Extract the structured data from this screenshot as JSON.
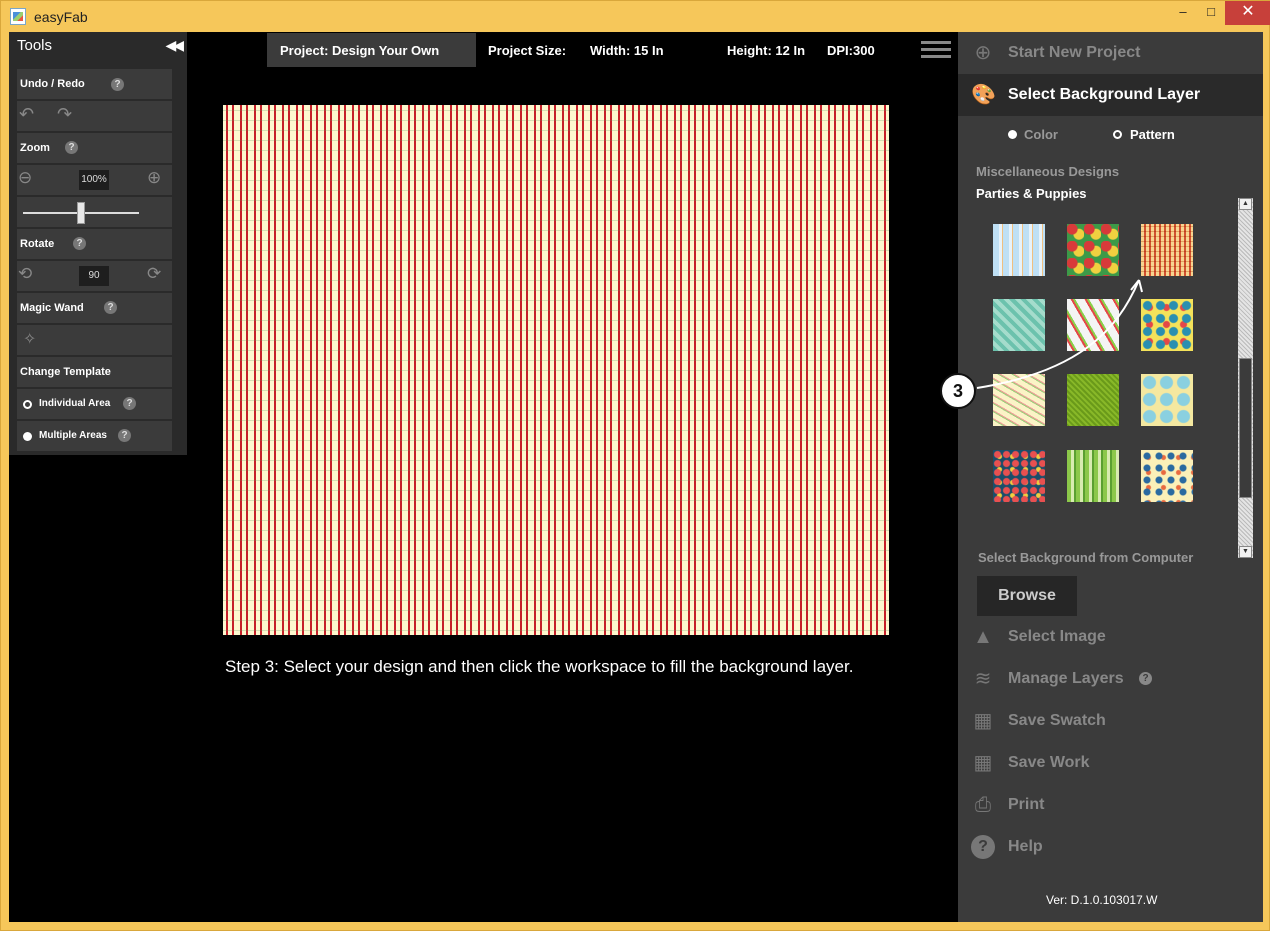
{
  "window": {
    "title": "easyFab",
    "minimize": "–",
    "maximize": "□",
    "close": "✕"
  },
  "tools": {
    "title": "Tools",
    "collapse": "◀◀",
    "undo_redo": "Undo / Redo",
    "zoom": "Zoom",
    "zoom_value": "100%",
    "zoom_slider_level": 0.5,
    "rotate": "Rotate",
    "rotate_value": "90",
    "magic_wand": "Magic Wand",
    "change_template": "Change Template",
    "individual_area": "Individual Area",
    "multiple_areas": "Multiple Areas",
    "help": "?"
  },
  "header": {
    "project": "Project: Design Your Own",
    "project_size": "Project Size:",
    "width": "Width: 15 In",
    "height": "Height: 12 In",
    "dpi": "DPI:300"
  },
  "step_text": "Step 3:    Select your design and then click the workspace to fill the background layer.",
  "right_panel": {
    "start_new": "Start New Project",
    "select_bg": "Select Background Layer",
    "color": "Color",
    "pattern": "Pattern",
    "selected_option": "Pattern",
    "category": "Miscellaneous Designs",
    "subcategory": "Parties & Puppies",
    "select_from_computer": "Select Background from Computer",
    "browse": "Browse",
    "select_image": "Select Image",
    "manage_layers": "Manage Layers",
    "save_swatch": "Save Swatch",
    "save_work": "Save Work",
    "print": "Print",
    "help": "Help",
    "version": "Ver: D.1.0.103017.W"
  },
  "callout": "3",
  "colors": {
    "accent_red": "#c6202a",
    "panel": "#3b3b3b",
    "dark": "#2a2a2a",
    "frame": "#f6c75a"
  }
}
